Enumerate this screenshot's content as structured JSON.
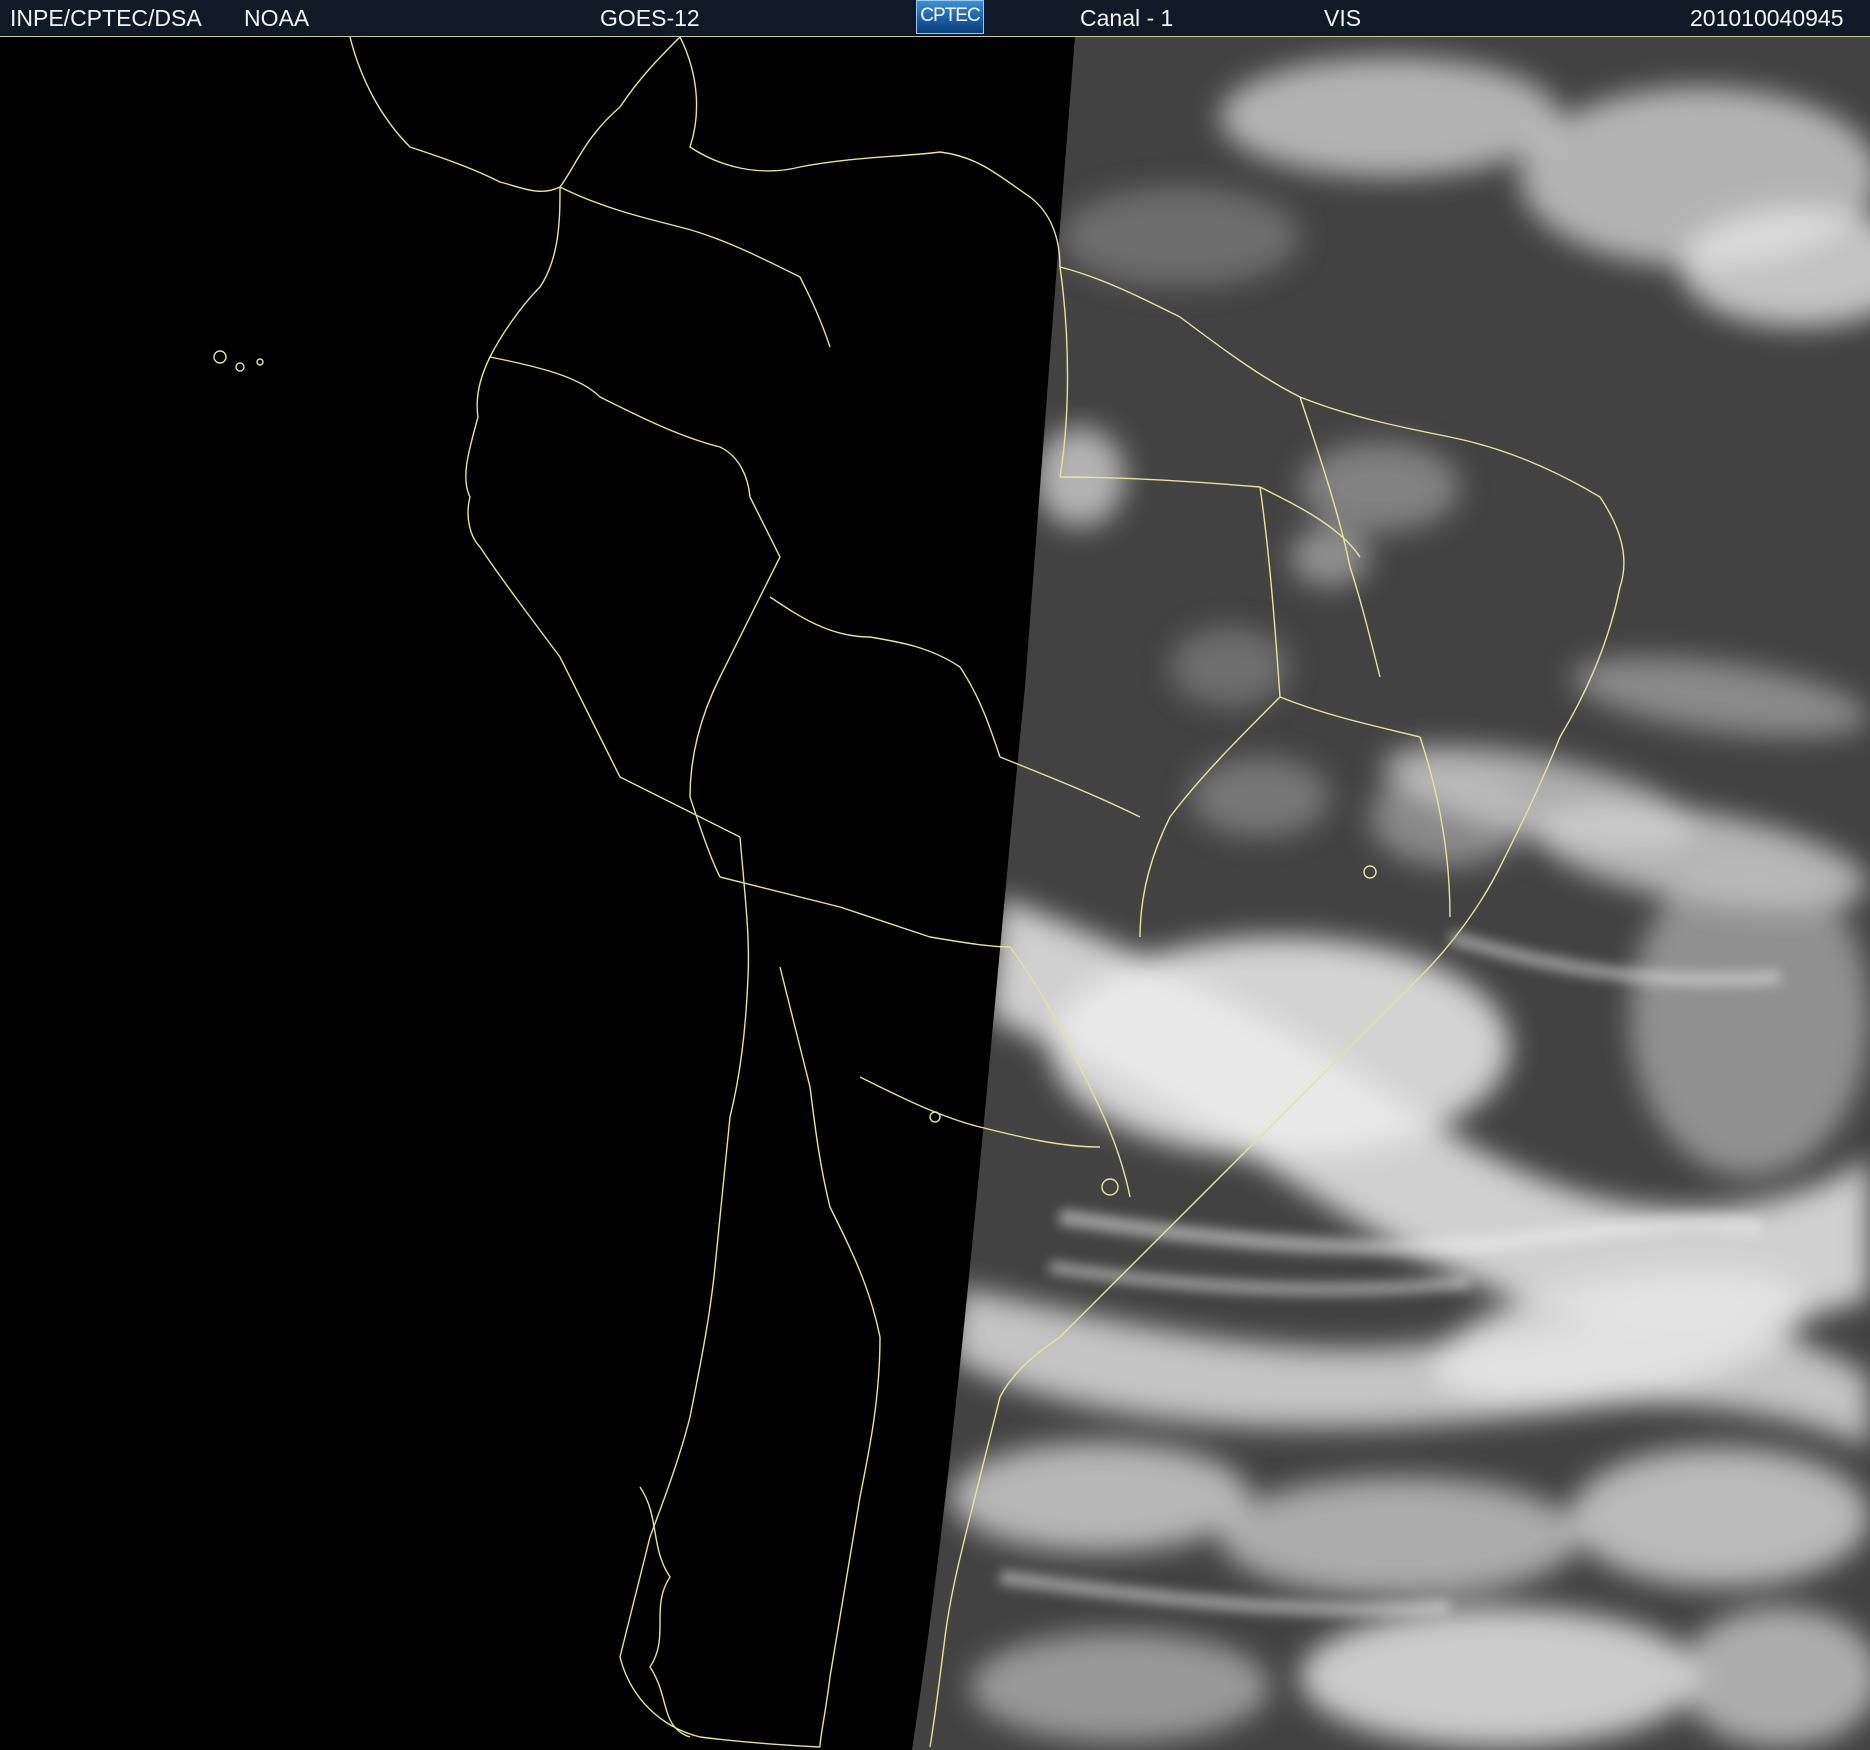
{
  "header": {
    "agency": "INPE/CPTEC/DSA",
    "source": "NOAA",
    "satellite": "GOES-12",
    "logo_text": "CPTEC",
    "channel": "Canal - 1",
    "band": "VIS",
    "timestamp": "201010040945"
  },
  "colors": {
    "header_bg": "#0f1a26",
    "boundary_lines": "#e6e29c",
    "night_side": "#000000",
    "day_side_sea": "#3c3c3c",
    "clouds": "#e8e8e8"
  },
  "map": {
    "region": "South America",
    "illumination": "terminator with night side on left, daylight visible imagery on right"
  }
}
